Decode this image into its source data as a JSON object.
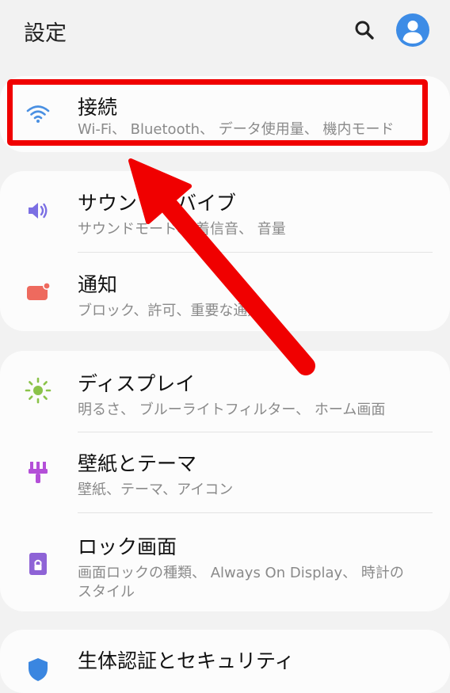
{
  "header": {
    "title": "設定"
  },
  "items": {
    "connections": {
      "title": "接続",
      "subtitle": "Wi-Fi、 Bluetooth、 データ使用量、 機内モード"
    },
    "sound": {
      "title": "サウンドとバイブ",
      "subtitle": "サウンドモード、 着信音、 音量"
    },
    "notifications": {
      "title": "通知",
      "subtitle": "ブロック、許可、重要な通知"
    },
    "display": {
      "title": "ディスプレイ",
      "subtitle": "明るさ、 ブルーライトフィルター、 ホーム画面"
    },
    "wallpaper": {
      "title": "壁紙とテーマ",
      "subtitle": "壁紙、テーマ、アイコン"
    },
    "lockscreen": {
      "title": "ロック画面",
      "subtitle_line1": "画面ロックの種類、 Always On Display、 時計の",
      "subtitle_line2": "スタイル"
    },
    "biometrics": {
      "title": "生体認証とセキュリティ"
    }
  },
  "colors": {
    "background": "#f2f2f2",
    "card": "#fcfcfc",
    "accent_blue": "#3d8ce6",
    "annotation_red": "#f00000",
    "wifi_icon": "#4a90e2",
    "sound_icon": "#7b6fe3",
    "notification_icon": "#ee6a5e",
    "display_icon": "#8bc34a",
    "wallpaper_icon": "#b44fd8",
    "lock_icon": "#8e63d6",
    "biometrics_icon": "#3a86e0"
  },
  "icons": {
    "search": "search-icon",
    "avatar": "account-icon",
    "connections": "wifi-icon",
    "sound": "volume-icon",
    "notifications": "notification-icon",
    "display": "brightness-icon",
    "wallpaper": "paintbrush-icon",
    "lockscreen": "lock-icon",
    "biometrics": "shield-icon"
  }
}
